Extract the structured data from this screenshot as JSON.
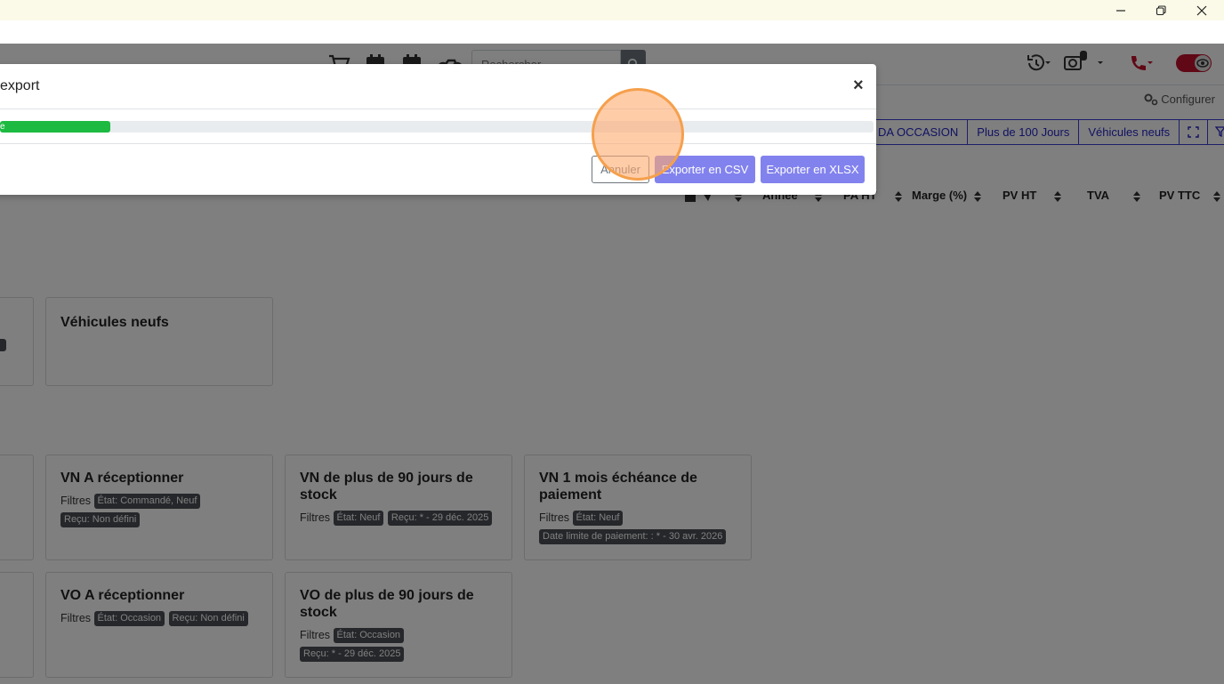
{
  "window": {
    "minimize_icon": "minimize-icon",
    "restore_icon": "restore-icon",
    "close_icon": "close-icon"
  },
  "navbar": {
    "search_placeholder": "Rechercher",
    "icons": [
      "cart-icon",
      "calendar-icon",
      "calendar-icon",
      "motorbike-icon",
      "history-icon",
      "camera-icon",
      "phone-icon",
      "eye-toggle-icon"
    ],
    "camera_badge": "0"
  },
  "toolbar": {
    "configure_label": "Configurer"
  },
  "filter_buttons": [
    "DA OCCASION",
    "Plus de 100 Jours",
    "Véhicules neufs"
  ],
  "table_headers": {
    "annee": "Année",
    "pa_ht": "PA HT",
    "marge": "Marge (%)",
    "pv_ht": "PV HT",
    "tva": "TVA",
    "pv_ttc": "PV TTC"
  },
  "cards": {
    "vehicules_neufs": {
      "title": "Véhicules neufs"
    },
    "vn_a_receptionner": {
      "title": "VN A réceptionner",
      "filters_label": "Filtres",
      "badges": [
        "État: Commandé, Neuf",
        "Reçu: Non défini"
      ]
    },
    "vn_90_jours": {
      "title": "VN de plus de 90 jours de stock",
      "filters_label": "Filtres",
      "badges": [
        "État: Neuf",
        "Reçu: * - 29 déc. 2025"
      ]
    },
    "vn_echeance": {
      "title": "VN 1 mois échéance de paiement",
      "filters_label": "Filtres",
      "badges": [
        "État: Neuf",
        "Date limite de paiement: : * - 30 avr. 2026"
      ]
    },
    "vo_a_receptionner": {
      "title": "VO A réceptionner",
      "filters_label": "Filtres",
      "badges": [
        "État: Occasion",
        "Reçu: Non défini"
      ]
    },
    "vo_90_jours": {
      "title": "VO de plus de 90 jours de stock",
      "filters_label": "Filtres",
      "badges": [
        "État: Occasion",
        "Reçu: * - 29 déc. 2025"
      ]
    }
  },
  "modal": {
    "title": "export",
    "close_label": "×",
    "progress_label": "e",
    "progress_fraction": 0.126,
    "cancel_label": "Annuler",
    "csv_label": "Exporter en CSV",
    "xlsx_label": "Exporter en XLSX"
  },
  "colors": {
    "accent": "#3b3bd6",
    "progress": "#1dba41",
    "export_button": "#8282ee",
    "click_highlight": "#f5a04c"
  }
}
